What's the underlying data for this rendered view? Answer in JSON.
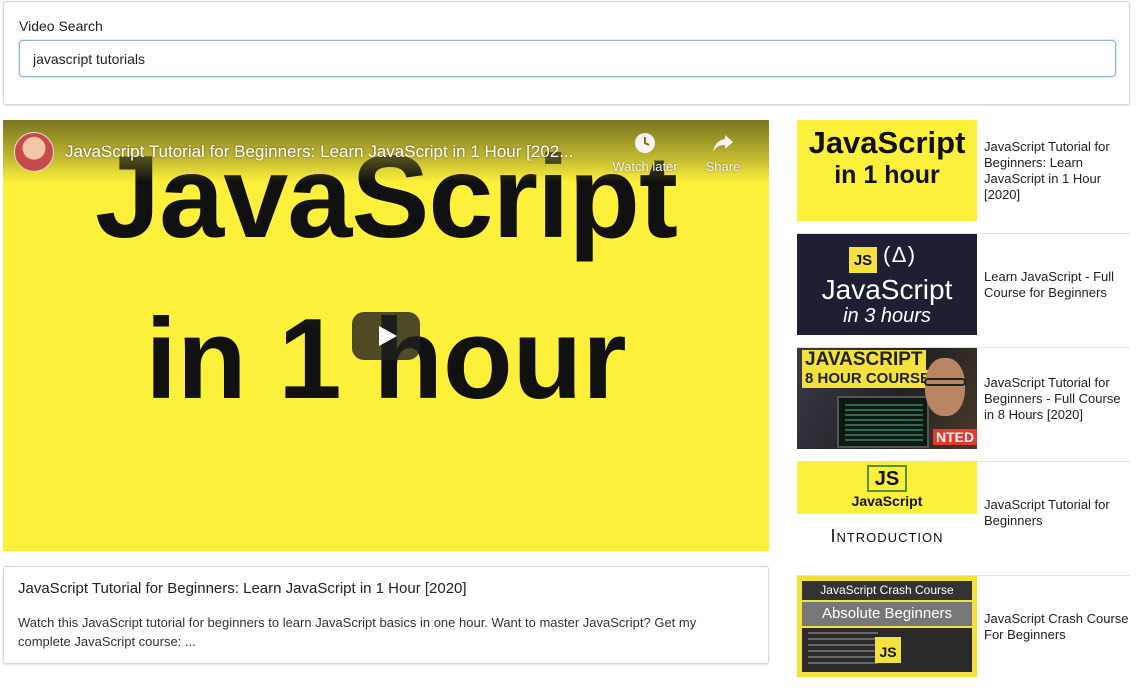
{
  "search": {
    "label": "Video Search",
    "value": "javascript tutorials"
  },
  "player": {
    "title": "JavaScript Tutorial for Beginners: Learn JavaScript in 1 Hour [202...",
    "watch_later": "Watch later",
    "share": "Share",
    "thumb_line1": "JavaScript",
    "thumb_line2": "in 1 hour"
  },
  "detail": {
    "title": "JavaScript Tutorial for Beginners: Learn JavaScript in 1 Hour [2020]",
    "description": "Watch this JavaScript tutorial for beginners to learn JavaScript basics in one hour. Want to master JavaScript? Get my complete JavaScript course: ..."
  },
  "videos": [
    {
      "title": "JavaScript Tutorial for Beginners: Learn JavaScript in 1 Hour [2020]",
      "thumb": [
        "JavaScript",
        "in 1 hour"
      ]
    },
    {
      "title": "Learn JavaScript - Full Course for Beginners",
      "thumb": [
        "JS",
        "(∆)",
        "JavaScript",
        "in 3 hours"
      ]
    },
    {
      "title": "JavaScript Tutorial for Beginners - Full Course in 8 Hours [2020]",
      "thumb": [
        "JAVASCRIPT",
        "8 HOUR COURSE",
        "NTED"
      ]
    },
    {
      "title": "JavaScript Tutorial for Beginners",
      "thumb": [
        "JS",
        "JavaScript",
        "Introduction"
      ]
    },
    {
      "title": "JavaScript Crash Course For Beginners",
      "thumb": [
        "JavaScript Crash Course",
        "Absolute Beginners",
        "JS"
      ]
    }
  ],
  "colors": {
    "thumb_yellow": "#fdf03a",
    "input_border": "#8ab7cc",
    "player_button": "#212121"
  }
}
